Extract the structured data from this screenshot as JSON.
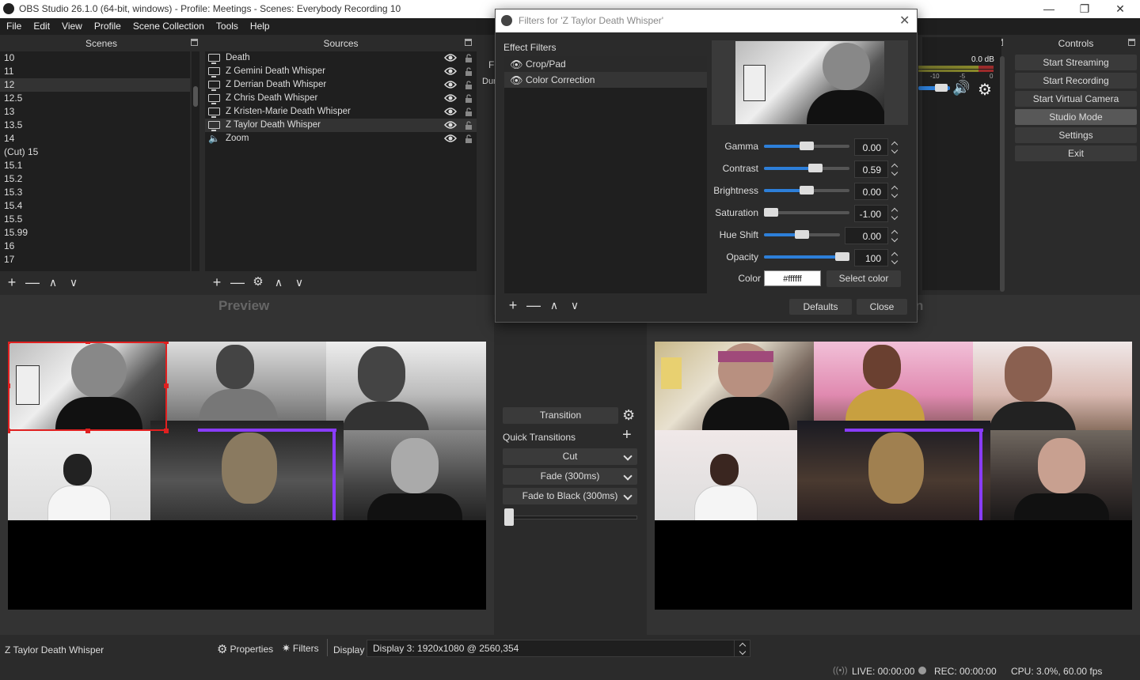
{
  "window": {
    "title": "OBS Studio 26.1.0 (64-bit, windows) - Profile: Meetings - Scenes: Everybody Recording  10"
  },
  "menu": [
    "File",
    "Edit",
    "View",
    "Profile",
    "Scene Collection",
    "Tools",
    "Help"
  ],
  "scenes": {
    "title": "Scenes",
    "items": [
      "10",
      "11",
      "12",
      "12.5",
      "13",
      "13.5",
      "14",
      "(Cut) 15",
      "15.1",
      "15.2",
      "15.3",
      "15.4",
      "15.5",
      "15.99",
      "16",
      "17"
    ],
    "selected_index": 2
  },
  "sources": {
    "title": "Sources",
    "items": [
      {
        "name": "Death",
        "icon": "monitor-icon"
      },
      {
        "name": "Z Gemini Death Whisper",
        "icon": "monitor-icon"
      },
      {
        "name": "Z Derrian Death Whisper",
        "icon": "monitor-icon"
      },
      {
        "name": "Z Chris Death Whisper",
        "icon": "monitor-icon"
      },
      {
        "name": "Z Kristen-Marie Death Whisper",
        "icon": "monitor-icon"
      },
      {
        "name": "Z Taylor Death Whisper",
        "icon": "monitor-icon"
      },
      {
        "name": "Zoom",
        "icon": "speaker-icon"
      }
    ],
    "selected_index": 5
  },
  "mixer": {
    "level": "0.0 dB",
    "ticks": [
      "-10",
      "-5",
      "0"
    ],
    "partial_label": "Dur",
    "partial_tab": "F"
  },
  "controls": {
    "title": "Controls",
    "buttons": [
      "Start Streaming",
      "Start Recording",
      "Start Virtual Camera",
      "Studio Mode",
      "Settings",
      "Exit"
    ],
    "active": "Studio Mode"
  },
  "preview": {
    "label": "Preview",
    "program_partial": "n"
  },
  "transitions": {
    "transition_button": "Transition",
    "quick_transitions": "Quick Transitions",
    "items": [
      "Cut",
      "Fade (300ms)",
      "Fade to Black (300ms)"
    ],
    "tbar_level": 0
  },
  "dialog": {
    "title": "Filters for 'Z Taylor Death Whisper'",
    "effect_filters_label": "Effect Filters",
    "filters": [
      "Crop/Pad",
      "Color Correction"
    ],
    "selected_filter": "Color Correction",
    "properties": [
      {
        "label": "Gamma",
        "value": "0.00",
        "fraction": 0.5
      },
      {
        "label": "Contrast",
        "value": "0.59",
        "fraction": 0.62
      },
      {
        "label": "Brightness",
        "value": "0.00",
        "fraction": 0.5
      },
      {
        "label": "Saturation",
        "value": "-1.00",
        "fraction": 0.0
      },
      {
        "label": "Hue Shift",
        "value": "0.00",
        "fraction": 0.5
      },
      {
        "label": "Opacity",
        "value": "100",
        "fraction": 1.0
      }
    ],
    "color_label": "Color",
    "color_value": "#ffffff",
    "select_color": "Select color",
    "defaults": "Defaults",
    "close": "Close"
  },
  "status": {
    "source_name": "Z Taylor Death Whisper",
    "properties": "Properties",
    "filters": "Filters",
    "display_label": "Display",
    "display_value": "Display 3: 1920x1080 @ 2560,354",
    "live": "LIVE: 00:00:00",
    "rec": "REC: 00:00:00",
    "cpu": "CPU: 3.0%, 60.00 fps"
  },
  "colors": {
    "accent": "#2d7fd9",
    "selection_border": "#e02020",
    "background": "#2b2b2b",
    "panel": "#1f1f1f"
  }
}
